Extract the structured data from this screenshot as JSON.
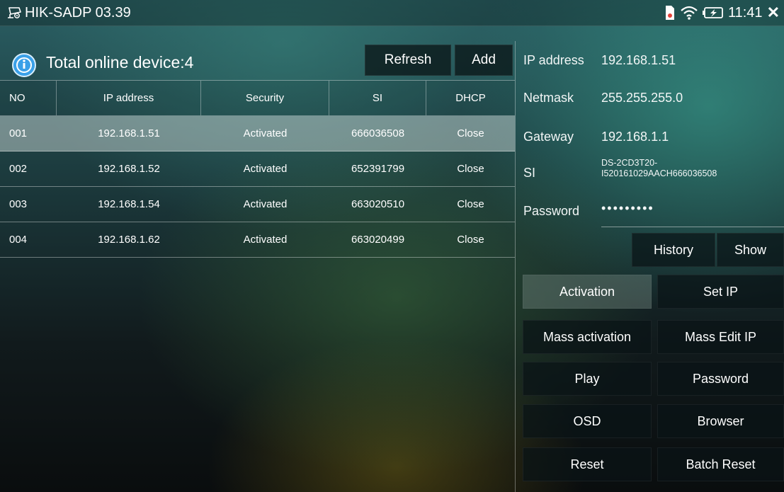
{
  "app": {
    "title": "HIK-SADP 03.39",
    "time": "11:41"
  },
  "devices": {
    "total_label": "Total online device:4",
    "refresh_label": "Refresh",
    "add_label": "Add",
    "columns": [
      "NO",
      "IP address",
      "Security",
      "SI",
      "DHCP"
    ],
    "rows": [
      {
        "no": "001",
        "ip": "192.168.1.51",
        "security": "Activated",
        "si": "666036508",
        "dhcp": "Close"
      },
      {
        "no": "002",
        "ip": "192.168.1.52",
        "security": "Activated",
        "si": "652391799",
        "dhcp": "Close"
      },
      {
        "no": "003",
        "ip": "192.168.1.54",
        "security": "Activated",
        "si": "663020510",
        "dhcp": "Close"
      },
      {
        "no": "004",
        "ip": "192.168.1.62",
        "security": "Activated",
        "si": "663020499",
        "dhcp": "Close"
      }
    ],
    "selected_row": "001"
  },
  "detail": {
    "ip_label": "IP address",
    "ip_value": "192.168.1.51",
    "netmask_label": "Netmask",
    "netmask_value": "255.255.255.0",
    "gateway_label": "Gateway",
    "gateway_value": "192.168.1.1",
    "si_label": "SI",
    "si_value_line1": "DS-2CD3T20-",
    "si_value_line2": "I520161029AACH666036508",
    "password_label": "Password",
    "password_value": "•••••••••",
    "history_label": "History",
    "show_label": "Show"
  },
  "actions": {
    "activation": "Activation",
    "set_ip": "Set IP",
    "mass_activation": "Mass activation",
    "mass_edit_ip": "Mass Edit IP",
    "play": "Play",
    "password": "Password",
    "osd": "OSD",
    "browser": "Browser",
    "reset": "Reset",
    "batch_reset": "Batch Reset"
  },
  "icons": [
    "camera-icon",
    "info-icon",
    "sim-card-icon",
    "wifi-icon",
    "battery-charging-icon",
    "close-icon"
  ],
  "colors": {
    "selected_row": "#b9c8c6",
    "button_bg": "#0a1416",
    "accent_icon": "#3aa0e8"
  }
}
